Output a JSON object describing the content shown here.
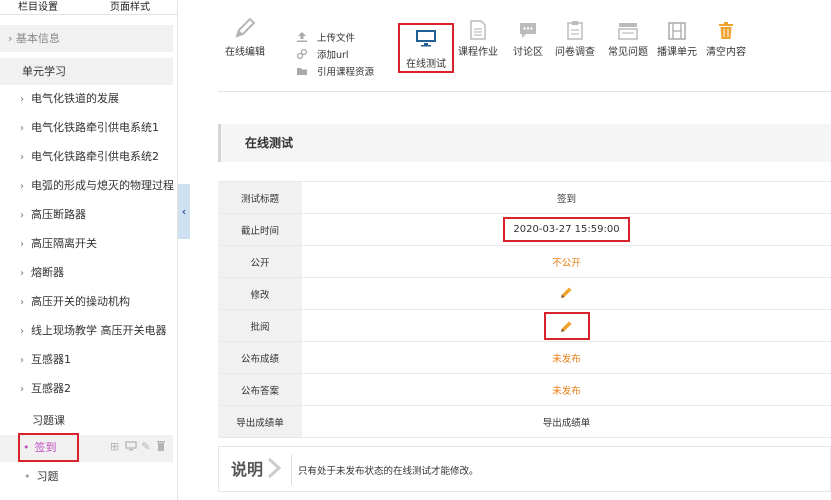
{
  "sidebar": {
    "tabs": [
      "栏目设置",
      "页面样式"
    ],
    "basic_info": "基本信息",
    "unit_header": "单元学习",
    "chapters": [
      "电气化铁道的发展",
      "电气化铁路牵引供电系统1",
      "电气化铁路牵引供电系统2",
      "电弧的形成与熄灭的物理过程",
      "高压断路器",
      "高压隔离开关",
      "熔断器",
      "高压开关的操动机构",
      "线上现场教学 高压开关电器",
      "互感器1",
      "互感器2"
    ],
    "exercise_course": "习题课",
    "active_item": "签到",
    "sub_item": "习题"
  },
  "toolbar": {
    "online_edit": "在线编辑",
    "upload_file": "上传文件",
    "add_url": "添加url",
    "cite_resource": "引用课程资源",
    "online_test": "在线测试",
    "homework": "课程作业",
    "discussion": "讨论区",
    "survey": "问卷调查",
    "faq": "常见问题",
    "broadcast": "播课单元",
    "clear": "清空内容"
  },
  "section_title": "在线测试",
  "table": {
    "rows": [
      {
        "key": "测试标题",
        "value": "签到"
      },
      {
        "key": "截止时间",
        "value": "2020-03-27 15:59:00"
      },
      {
        "key": "公开",
        "value": "不公开"
      },
      {
        "key": "修改",
        "value": ""
      },
      {
        "key": "批阅",
        "value": ""
      },
      {
        "key": "公布成绩",
        "value": "未发布"
      },
      {
        "key": "公布答案",
        "value": "未发布"
      },
      {
        "key": "导出成绩单",
        "value": "导出成绩单"
      }
    ]
  },
  "note": {
    "title": "说明",
    "text": "只有处于未发布状态的在线测试才能修改。"
  },
  "colors": {
    "highlight": "#d9232a",
    "orange_status": "#e87d14",
    "active_purple": "#c04fc0",
    "selected_tool_blue": "#1f5f96"
  }
}
